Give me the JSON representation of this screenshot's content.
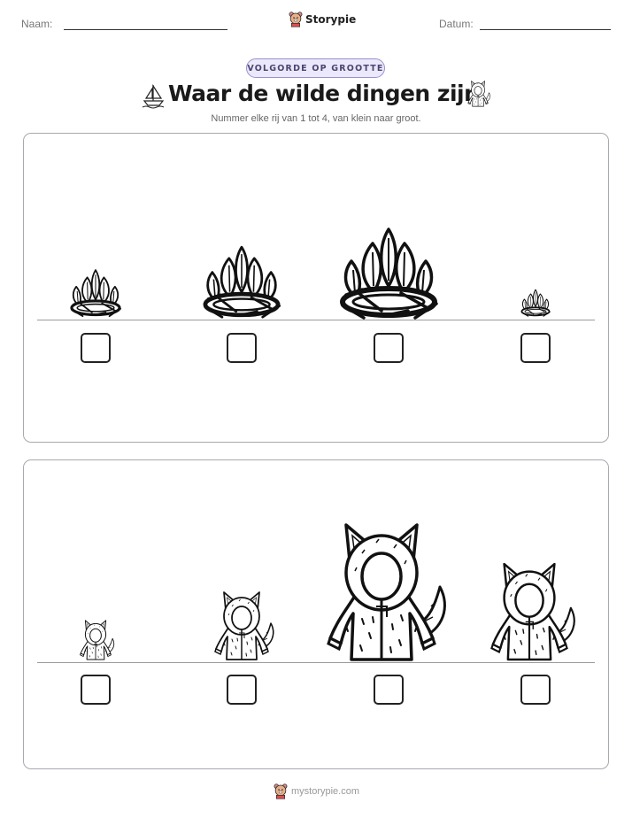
{
  "header": {
    "name_label": "Naam:",
    "date_label": "Datum:",
    "brand": "Storypie",
    "brand_icon": "storypie-bear-logo"
  },
  "worksheet": {
    "category": "VOLGORDE OP GROOTTE",
    "title": "Waar de wilde dingen zijn",
    "title_left_icon": "sailboat-icon",
    "title_right_icon": "wolf-costume-icon",
    "instruction": "Nummer elke rij van 1 tot 4, van klein naar groot."
  },
  "rows": [
    {
      "item": "crown-of-leaves",
      "relative_sizes": [
        0.52,
        0.79,
        1.0,
        0.3
      ]
    },
    {
      "item": "wolf-costume",
      "relative_sizes": [
        0.29,
        0.5,
        1.0,
        0.71
      ]
    }
  ],
  "footer": {
    "text": "mystorypie.com",
    "icon": "storypie-bear-logo"
  }
}
